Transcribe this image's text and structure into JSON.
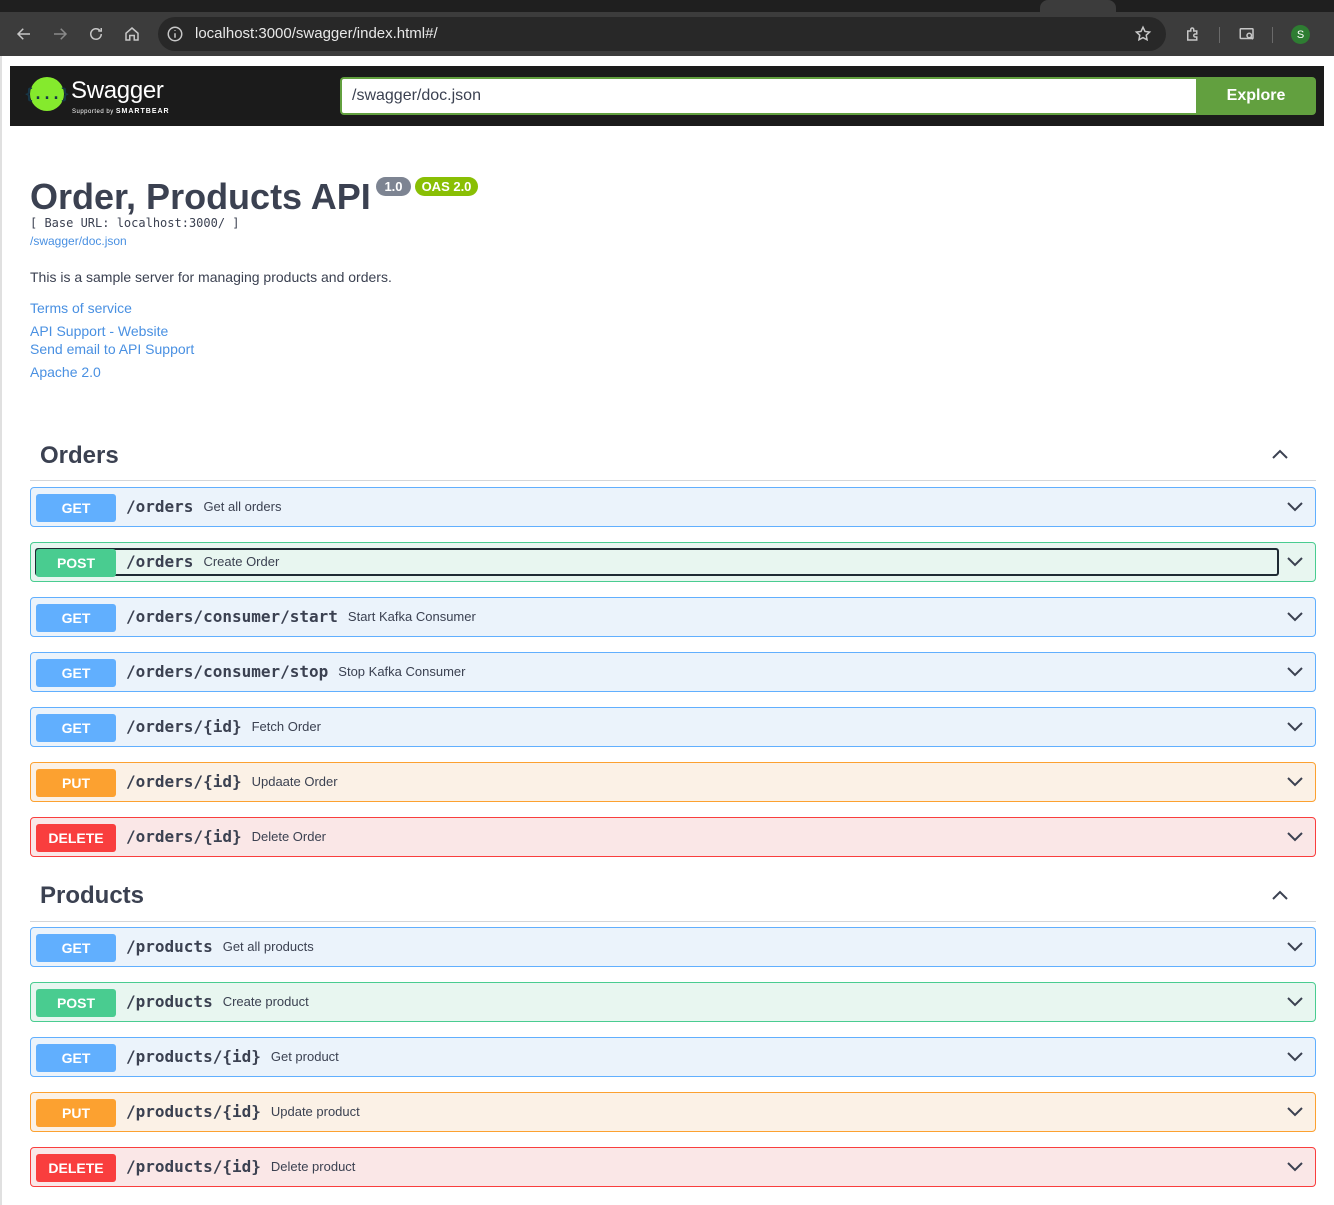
{
  "browser": {
    "url": "localhost:3000/swagger/index.html#/",
    "profile_initial": "S"
  },
  "topbar": {
    "logo_text": "Swagger",
    "logo_subtext": "Supported by",
    "logo_brand": "SMARTBEAR",
    "logo_glyph": "{...}",
    "spec_url": "/swagger/doc.json",
    "explore_label": "Explore"
  },
  "info": {
    "title": "Order, Products API",
    "version": "1.0",
    "oas": "OAS 2.0",
    "base_url": "[ Base URL: localhost:3000/ ]",
    "doc_link": "/swagger/doc.json",
    "description": "This is a sample server for managing products and orders.",
    "terms": "Terms of service",
    "support_website": "API Support - Website",
    "support_email": "Send email to API Support",
    "license": "Apache 2.0"
  },
  "sections": [
    {
      "name": "Orders",
      "operations": [
        {
          "method": "GET",
          "path": "/orders",
          "summary": "Get all orders"
        },
        {
          "method": "POST",
          "path": "/orders",
          "summary": "Create Order"
        },
        {
          "method": "GET",
          "path": "/orders/consumer/start",
          "summary": "Start Kafka Consumer"
        },
        {
          "method": "GET",
          "path": "/orders/consumer/stop",
          "summary": "Stop Kafka Consumer"
        },
        {
          "method": "GET",
          "path": "/orders/{id}",
          "summary": "Fetch Order"
        },
        {
          "method": "PUT",
          "path": "/orders/{id}",
          "summary": "Updaate Order"
        },
        {
          "method": "DELETE",
          "path": "/orders/{id}",
          "summary": "Delete Order"
        }
      ]
    },
    {
      "name": "Products",
      "operations": [
        {
          "method": "GET",
          "path": "/products",
          "summary": "Get all products"
        },
        {
          "method": "POST",
          "path": "/products",
          "summary": "Create product"
        },
        {
          "method": "GET",
          "path": "/products/{id}",
          "summary": "Get product"
        },
        {
          "method": "PUT",
          "path": "/products/{id}",
          "summary": "Update product"
        },
        {
          "method": "DELETE",
          "path": "/products/{id}",
          "summary": "Delete product"
        }
      ]
    }
  ],
  "colors": {
    "get": "#61affe",
    "post": "#49cc90",
    "put": "#fca130",
    "delete": "#f93e3e",
    "explore": "#62a03f",
    "link": "#4990e2"
  }
}
